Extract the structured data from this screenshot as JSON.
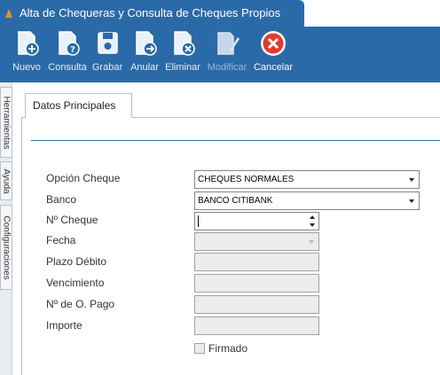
{
  "window": {
    "title": "Alta de Chequeras y Consulta de Cheques Propios"
  },
  "toolbar": {
    "buttons": [
      {
        "label": "Nuevo",
        "icon": "new-document-icon",
        "enabled": true
      },
      {
        "label": "Consulta",
        "icon": "query-document-icon",
        "enabled": true
      },
      {
        "label": "Grabar",
        "icon": "save-disk-icon",
        "enabled": true
      },
      {
        "label": "Anular",
        "icon": "void-document-icon",
        "enabled": true
      },
      {
        "label": "Eliminar",
        "icon": "delete-document-icon",
        "enabled": true
      },
      {
        "label": "Modificar",
        "icon": "edit-pencil-icon",
        "enabled": false
      },
      {
        "label": "Cancelar",
        "icon": "cancel-circle-icon",
        "enabled": true
      }
    ]
  },
  "side_tabs": [
    "Herramientas",
    "Ayuda",
    "Configuraciones"
  ],
  "tabs": {
    "active": "Datos Principales"
  },
  "form": {
    "opcion_cheque": {
      "label": "Opción Cheque",
      "value": "CHEQUES NORMALES"
    },
    "banco": {
      "label": "Banco",
      "value": "BANCO CITIBANK"
    },
    "numero_cheque": {
      "label": "Nº Cheque",
      "value": ""
    },
    "fecha": {
      "label": "Fecha",
      "value": ""
    },
    "plazo_debito": {
      "label": "Plazo Débito",
      "value": ""
    },
    "vencimiento": {
      "label": "Vencimiento",
      "value": ""
    },
    "numero_orden_pago": {
      "label": "Nº de O. Pago",
      "value": ""
    },
    "importe": {
      "label": "Importe",
      "value": ""
    },
    "firmado": {
      "label": "Firmado",
      "checked": false
    }
  },
  "colors": {
    "accent": "#2a6aa8",
    "cancel": "#e23b2e",
    "separator": "#2a6aa8"
  }
}
